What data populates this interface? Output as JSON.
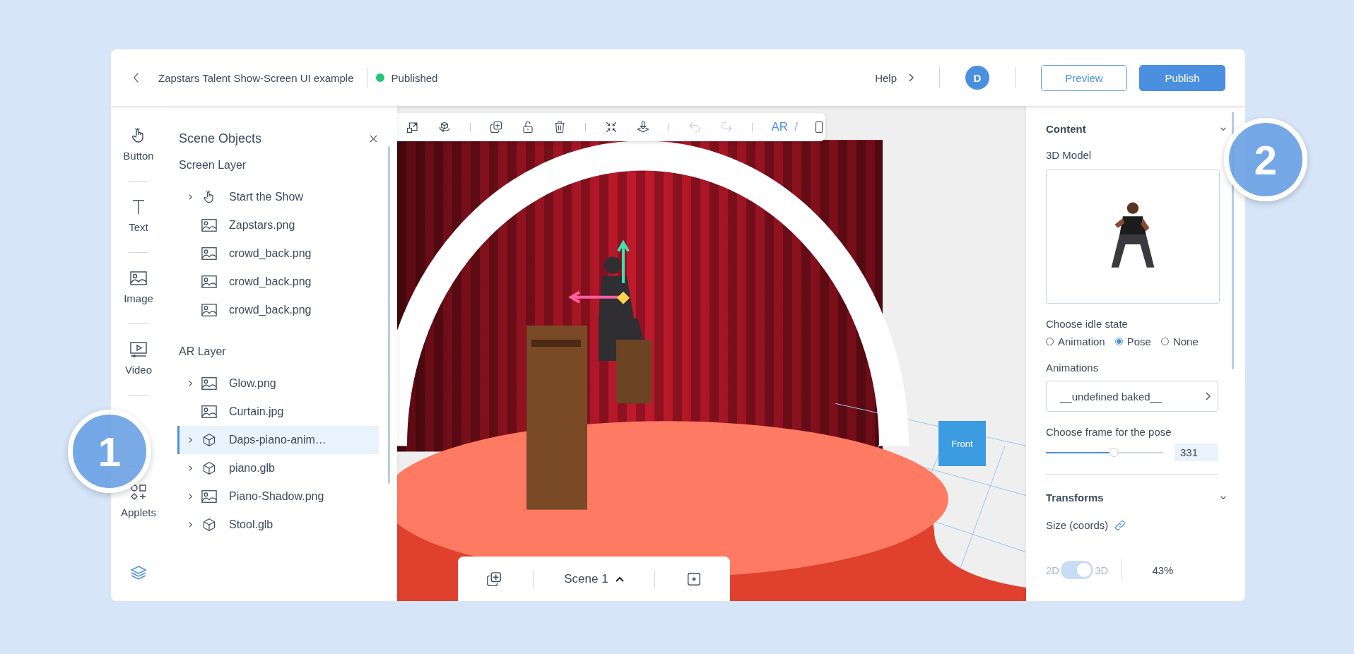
{
  "topbar": {
    "title": "Zapstars Talent Show-Screen UI example",
    "status": "Published",
    "help": "Help",
    "avatar": "D",
    "preview": "Preview",
    "publish": "Publish"
  },
  "rail": {
    "items": [
      {
        "kind": "button",
        "label": "Button"
      },
      {
        "kind": "text",
        "label": "Text"
      },
      {
        "kind": "image",
        "label": "Image"
      },
      {
        "kind": "video",
        "label": "Video"
      },
      {
        "kind": "applets",
        "label": "Applets"
      }
    ]
  },
  "panel": {
    "title": "Scene Objects",
    "sections": [
      {
        "title": "Screen Layer",
        "items": [
          {
            "kind": "button",
            "label": "Start the Show",
            "expandable": true,
            "selected": false
          },
          {
            "kind": "image",
            "label": "Zapstars.png",
            "expandable": false,
            "selected": false
          },
          {
            "kind": "image",
            "label": "crowd_back.png",
            "expandable": false,
            "selected": false
          },
          {
            "kind": "image",
            "label": "crowd_back.png",
            "expandable": false,
            "selected": false
          },
          {
            "kind": "image",
            "label": "crowd_back.png",
            "expandable": false,
            "selected": false
          }
        ]
      },
      {
        "title": "AR Layer",
        "items": [
          {
            "kind": "image",
            "label": "Glow.png",
            "expandable": true,
            "selected": false
          },
          {
            "kind": "image",
            "label": "Curtain.jpg",
            "expandable": false,
            "selected": false
          },
          {
            "kind": "model",
            "label": "Daps-piano-anim…",
            "expandable": true,
            "selected": true
          },
          {
            "kind": "model",
            "label": "piano.glb",
            "expandable": true,
            "selected": false
          },
          {
            "kind": "image",
            "label": "Piano-Shadow.png",
            "expandable": true,
            "selected": false
          },
          {
            "kind": "model",
            "label": "Stool.glb",
            "expandable": true,
            "selected": false
          }
        ]
      }
    ]
  },
  "toolbar": {
    "tools": [
      {
        "kind": "resize",
        "disabled": false
      },
      {
        "kind": "rotate",
        "disabled": false
      },
      {
        "kind": "sep"
      },
      {
        "kind": "duplicate",
        "disabled": false
      },
      {
        "kind": "unlock",
        "disabled": false
      },
      {
        "kind": "trash",
        "disabled": false
      },
      {
        "kind": "sep"
      },
      {
        "kind": "compress",
        "disabled": false
      },
      {
        "kind": "drop",
        "disabled": false
      },
      {
        "kind": "sep"
      },
      {
        "kind": "undo",
        "disabled": true
      },
      {
        "kind": "redo",
        "disabled": true
      },
      {
        "kind": "sep"
      }
    ],
    "mode": "AR",
    "mode_separator": "/"
  },
  "canvas": {
    "front_label": "Front"
  },
  "scene_bar": {
    "label": "Scene 1"
  },
  "properties": {
    "content": {
      "title": "Content",
      "model_label": "3D Model",
      "idle_label": "Choose idle state",
      "idle_options": [
        {
          "label": "Animation",
          "selected": false
        },
        {
          "label": "Pose",
          "selected": true
        },
        {
          "label": "None",
          "selected": false
        }
      ],
      "animations_label": "Animations",
      "animation_value": "__undefined baked__",
      "frame_label": "Choose frame for the pose",
      "frame": {
        "level": 0.58
      },
      "frame_value": "331"
    },
    "transforms": {
      "title": "Transforms",
      "size_label": "Size (coords)",
      "toggle": {
        "left": "2D",
        "right": "3D",
        "on": true,
        "disabled": true
      },
      "zoom": "43%"
    }
  },
  "callouts": [
    "1",
    "2"
  ]
}
